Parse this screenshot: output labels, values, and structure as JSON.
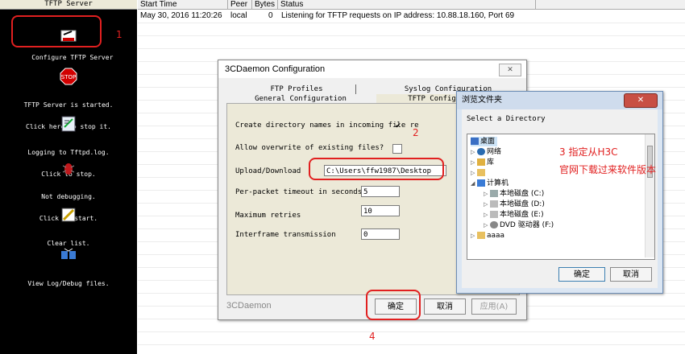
{
  "left_panel": {
    "header": "TFTP Server",
    "items": [
      {
        "label_line1": "Configure TFTP Server",
        "label_line2": "",
        "icon": "config-icon"
      },
      {
        "label_line1": "TFTP Server is started.",
        "label_line2": "Click here to stop it.",
        "icon": "stop-icon"
      },
      {
        "label_line1": "Logging to Tftpd.log.",
        "label_line2": "Click to stop.",
        "icon": "log-icon"
      },
      {
        "label_line1": "Not debugging.",
        "label_line2": "Click to start.",
        "icon": "bug-icon"
      },
      {
        "label_line1": "Clear list.",
        "label_line2": "",
        "icon": "clear-icon"
      },
      {
        "label_line1": "View Log/Debug files.",
        "label_line2": "",
        "icon": "view-files-icon"
      }
    ]
  },
  "table": {
    "columns": [
      "Start Time",
      "Peer",
      "Bytes",
      "Status"
    ],
    "rows": [
      {
        "start_time": "May 30, 2016 11:20:26",
        "peer": "local",
        "bytes": "0",
        "status": "Listening for TFTP requests on IP address: 10.88.18.160, Port 69"
      }
    ]
  },
  "config_dialog": {
    "title": "3CDaemon Configuration",
    "close": "✕",
    "tabs_row1": [
      "FTP Profiles",
      "Syslog Configuration"
    ],
    "tabs_row2": [
      "General Configuration",
      "TFTP Configuration"
    ],
    "fields": {
      "create_dir_label": "Create directory names in incoming file re",
      "create_dir_checked": "✔",
      "overwrite_label": "Allow overwrite of existing files?",
      "upload_label": "Upload/Download",
      "upload_value": "C:\\Users\\ffw1987\\Desktop",
      "timeout_label": "Per-packet timeout in seconds",
      "timeout_value": "5",
      "retries_label": "Maximum retries",
      "retries_value": "10",
      "interframe_label": "Interframe transmission",
      "interframe_value": "0"
    },
    "footer_brand": "3CDaemon",
    "ok": "确定",
    "cancel": "取消",
    "apply": "应用(A)"
  },
  "browse_dialog": {
    "title": "浏览文件夹",
    "close": "✕",
    "prompt": "Select a Directory",
    "tree": [
      "桌面",
      "网络",
      "库",
      "",
      "计算机",
      "本地磁盘 (C:)",
      "本地磁盘 (D:)",
      "本地磁盘 (E:)",
      "DVD 驱动器 (F:)",
      "aaaa"
    ],
    "ok": "确定",
    "cancel": "取消"
  },
  "annotations": {
    "n1": "1",
    "n2": "2",
    "n3_line1": "3 指定从H3C",
    "n3_line2": "官网下载过来软件版本",
    "n4": "4",
    "color": "#e12020"
  }
}
